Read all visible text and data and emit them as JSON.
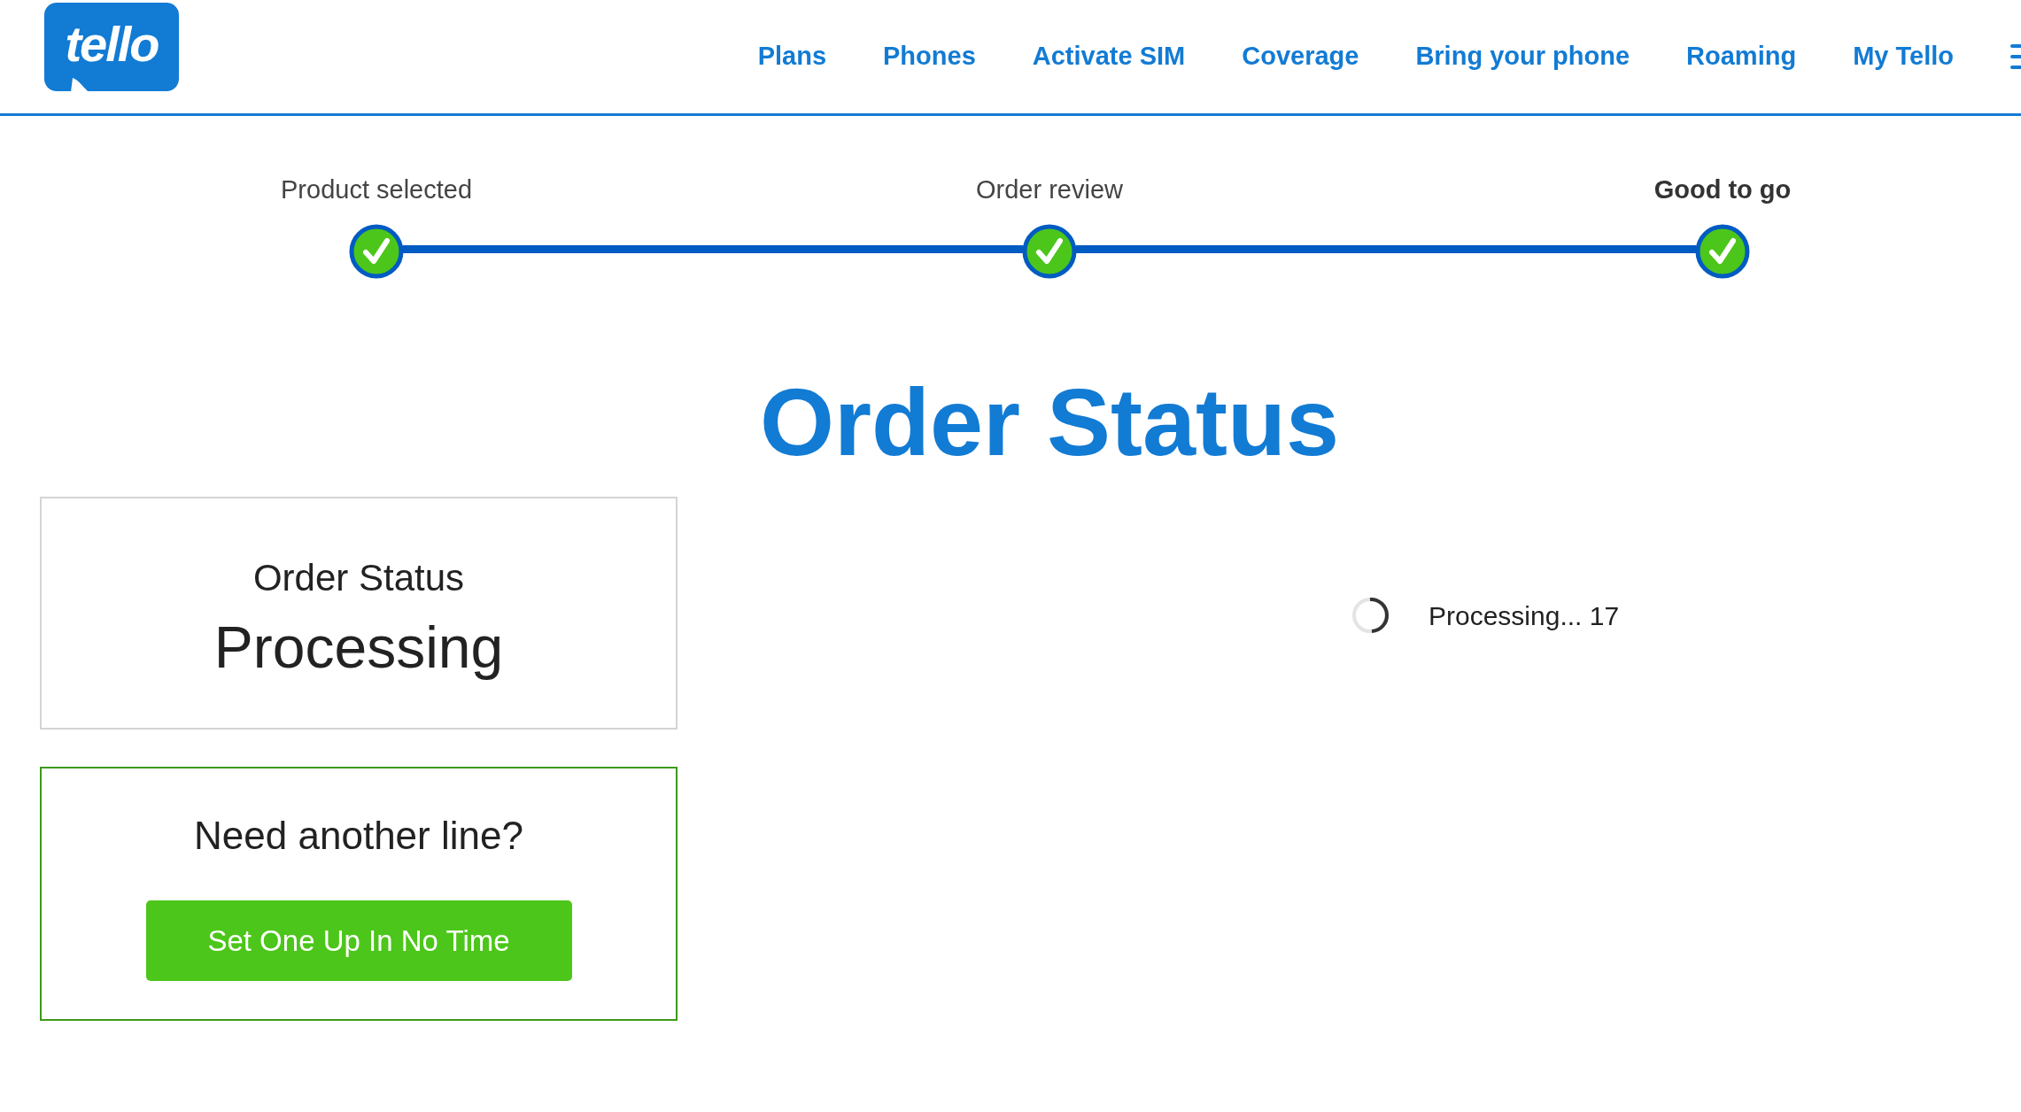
{
  "header": {
    "logo": "tello",
    "nav": [
      {
        "label": "Plans"
      },
      {
        "label": "Phones"
      },
      {
        "label": "Activate SIM"
      },
      {
        "label": "Coverage"
      },
      {
        "label": "Bring your phone"
      },
      {
        "label": "Roaming"
      },
      {
        "label": "My Tello"
      }
    ]
  },
  "steps": [
    {
      "label": "Product selected",
      "done": true,
      "selected": false
    },
    {
      "label": "Order review",
      "done": true,
      "selected": false
    },
    {
      "label": "Good to go",
      "done": true,
      "selected": true
    }
  ],
  "heading": "Order Status",
  "status_card": {
    "title": "Order Status",
    "value": "Processing"
  },
  "line_card": {
    "title": "Need another line?",
    "button": "Set One Up In No Time"
  },
  "progress": {
    "text": "Processing... 17"
  }
}
